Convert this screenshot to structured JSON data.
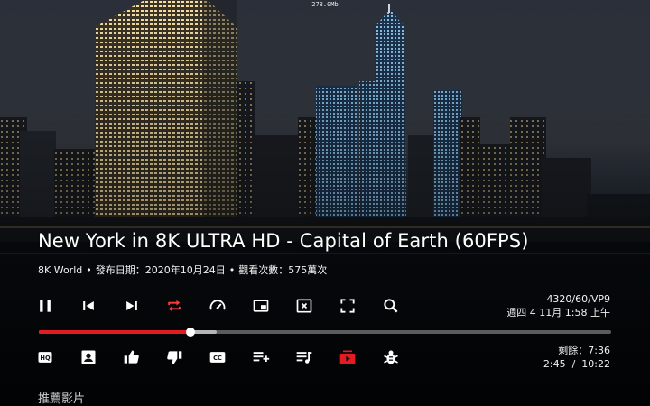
{
  "overlay": {
    "memory_usage": "278.0Mb"
  },
  "video": {
    "title": "New York in 8K ULTRA HD - Capital of Earth (60FPS)",
    "channel": "8K World",
    "separator": "•",
    "published": "發布日期：2020年10月24日",
    "views": "觀看次數：575萬次",
    "format": "4320/60/VP9",
    "clock": "週四 4 11月 1:58 上午",
    "remaining": "剩餘：7:36",
    "time_position": "2:45  /  10:22",
    "progress_played_fraction": 0.265,
    "progress_buffered_fraction": 0.31
  },
  "controls_row1": [
    "pause-icon",
    "skip-previous-icon",
    "skip-next-icon",
    "repeat-icon",
    "speed-icon",
    "picture-in-picture-icon",
    "close-box-icon",
    "fullscreen-icon",
    "search-icon"
  ],
  "controls_row2": [
    "hq-icon",
    "channel-icon",
    "like-icon",
    "dislike-icon",
    "closed-captions-icon",
    "add-to-playlist-icon",
    "playlist-music-icon",
    "subscribe-icon",
    "debug-icon"
  ],
  "colors": {
    "accent_red": "#e51b23",
    "repeat_active": "#ff3b3b"
  },
  "sections": {
    "recommended": "推薦影片"
  }
}
